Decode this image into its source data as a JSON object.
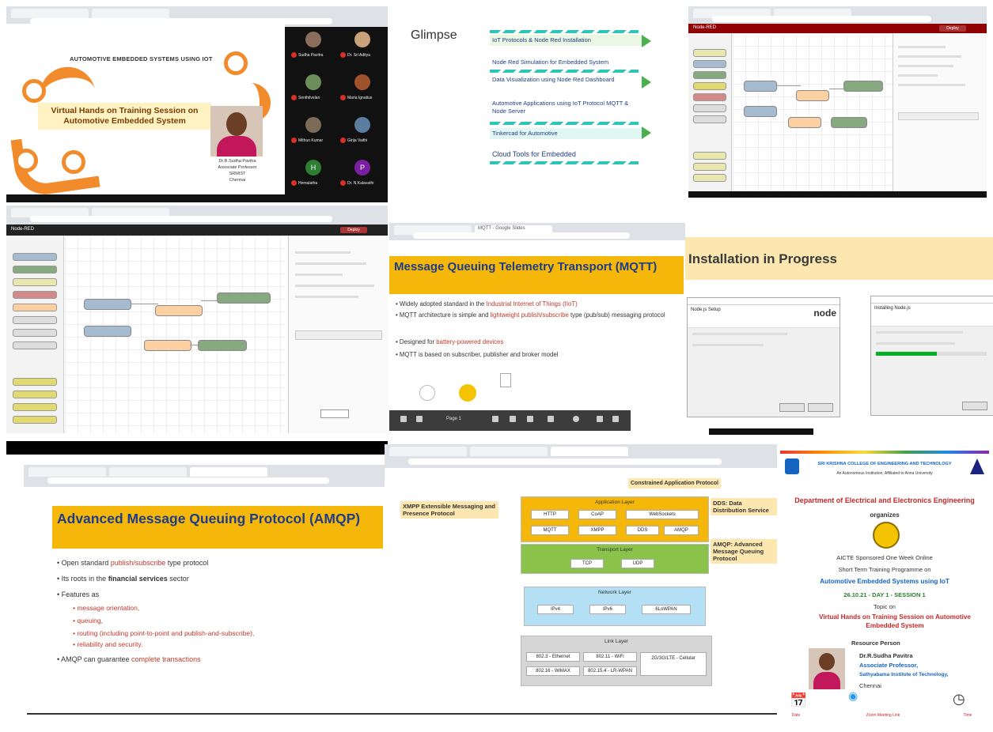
{
  "webinar": {
    "banner_title": "AUTOMOTIVE EMBEDDED SYSTEMS USING IOT",
    "session_title": "Virtual Hands on Training Session on Automotive Embedded System",
    "presenter_caption": [
      "Dr.R.Sudha Pavitra",
      "Associate Professor",
      "SRMIST",
      "Chennai"
    ],
    "participants": [
      {
        "name": "Sudha Pavitra",
        "avatar_color": "#8a6d5a"
      },
      {
        "name": "Dr. Sri Aditya",
        "avatar_color": "#c9a17a"
      },
      {
        "name": "Senthilvelan",
        "avatar_color": "#6b8e5a"
      },
      {
        "name": "Maria Ignatius",
        "avatar_color": "#a0522d"
      },
      {
        "name": "Mithun Kumar",
        "avatar_color": "#7d6b5a"
      },
      {
        "name": "Girija Vaithi",
        "avatar_color": "#5b7ea0"
      },
      {
        "name": "Hemalatha",
        "avatar_color": "#2e7d32",
        "initial": "H"
      },
      {
        "name": "Dr. N.Kalavathi",
        "avatar_color": "#7b1fa2",
        "initial": "P"
      }
    ]
  },
  "glimpse": {
    "title": "Glimpse",
    "items": [
      "IoT Protocols & Node Red Installation",
      "Node Red Simulation for Embedded System",
      "Data Visualization using Node Red Dashboard",
      "Automotive Applications using IoT Protocol MQTT & Node Server",
      "Tinkercad for Automotive",
      "Cloud Tools for Embedded"
    ]
  },
  "nodered_a": {
    "title": "Node-RED",
    "deploy_label": "Deploy"
  },
  "nodered_b": {
    "title": "Node-RED",
    "deploy_label": "Deploy"
  },
  "mqtt": {
    "tab_label": "MQTT - Google Slides",
    "title": "Message Queuing Telemetry Transport (MQTT)",
    "bullets": [
      {
        "pre": "• Widely adopted standard in the ",
        "hl": "Industrial Internet of Things (IIoT)",
        "post": ""
      },
      {
        "pre": "• MQTT architecture is simple and ",
        "hl": "lightweight publish/subscribe",
        "post": " type (pub/sub) messaging protocol"
      },
      {
        "pre": "• Designed for ",
        "hl": "battery-powered devices",
        "post": ""
      },
      {
        "pre": "• MQTT is based on subscriber, publisher and broker model",
        "hl": "",
        "post": ""
      }
    ],
    "toolbar_page": "Page 1"
  },
  "install": {
    "title": "Installation in Progress",
    "dialog1_heading": "Node.js Setup",
    "dialog1_logo": "node",
    "dialog2_heading": "Installing Node.js",
    "progress": 0.55
  },
  "amqp": {
    "title": "Advanced Message Queuing Protocol (AMQP)",
    "b1_pre": "• Open standard ",
    "b1_hl": "publish/subscribe",
    "b1_post": " type protocol",
    "b2_pre": "• Its roots in the ",
    "b2_bold": "financial services",
    "b2_post": " sector",
    "b3": "• Features as",
    "subs": [
      "• message orientation,",
      "• queuing,",
      "• routing (including point-to-point and publish-and-subscribe),",
      "• reliability and security."
    ],
    "b4_pre": "• AMQP can guarantee ",
    "b4_hl": "complete transactions"
  },
  "stack": {
    "header": "Constrained Application Protocol",
    "left_note": "XMPP Extensible Messaging and Presence Protocol",
    "right_note1": "DDS: Data Distribution Service",
    "right_note2": "AMQP: Advanced Message Queuing Protocol",
    "app_layer": {
      "title": "Application Layer",
      "cells": [
        "HTTP",
        "CoAP",
        "WebSockets",
        "MQTT",
        "XMPP",
        "DDS",
        "AMQP"
      ]
    },
    "transport_layer": {
      "title": "Transport Layer",
      "cells": [
        "TCP",
        "UDP"
      ]
    },
    "network_layer": {
      "title": "Network Layer",
      "cells": [
        "IPv4",
        "IPv6",
        "6LoWPAN"
      ]
    },
    "link_layer": {
      "title": "Link Layer",
      "cells": [
        "802.3 - Ethernet",
        "802.11 - WiFi",
        "802.15.4 - LR-WPAN",
        "2G/3G/LTE - Cellular",
        "802.16 - WiMAX"
      ]
    }
  },
  "poster": {
    "college": "SRI KRISHNA COLLEGE OF ENGINEERING AND TECHNOLOGY",
    "college_sub": "An Autonomous Institution, Affiliated to Anna University",
    "department": "Department of Electrical and Electronics Engineering",
    "organizes": "organizes",
    "program": "AICTE Sponsored One Week Online",
    "program2": "Short Term Training Programme on",
    "topic": "Automotive Embedded Systems using IoT",
    "date": "26.10.21 - DAY 1 - SESSION 1",
    "topic_label": "Topic on",
    "session": "Virtual Hands on Training Session on Automotive Embedded System",
    "resource_label": "Resource Person",
    "person": "Dr.R.Sudha Pavitra",
    "role": "Associate Professor,",
    "inst": "Sathyabama Institute of Technology,",
    "city": "Chennai",
    "zoom_text": "Zoom Meeting Link",
    "date_label": "Date",
    "time_label": "Time"
  }
}
